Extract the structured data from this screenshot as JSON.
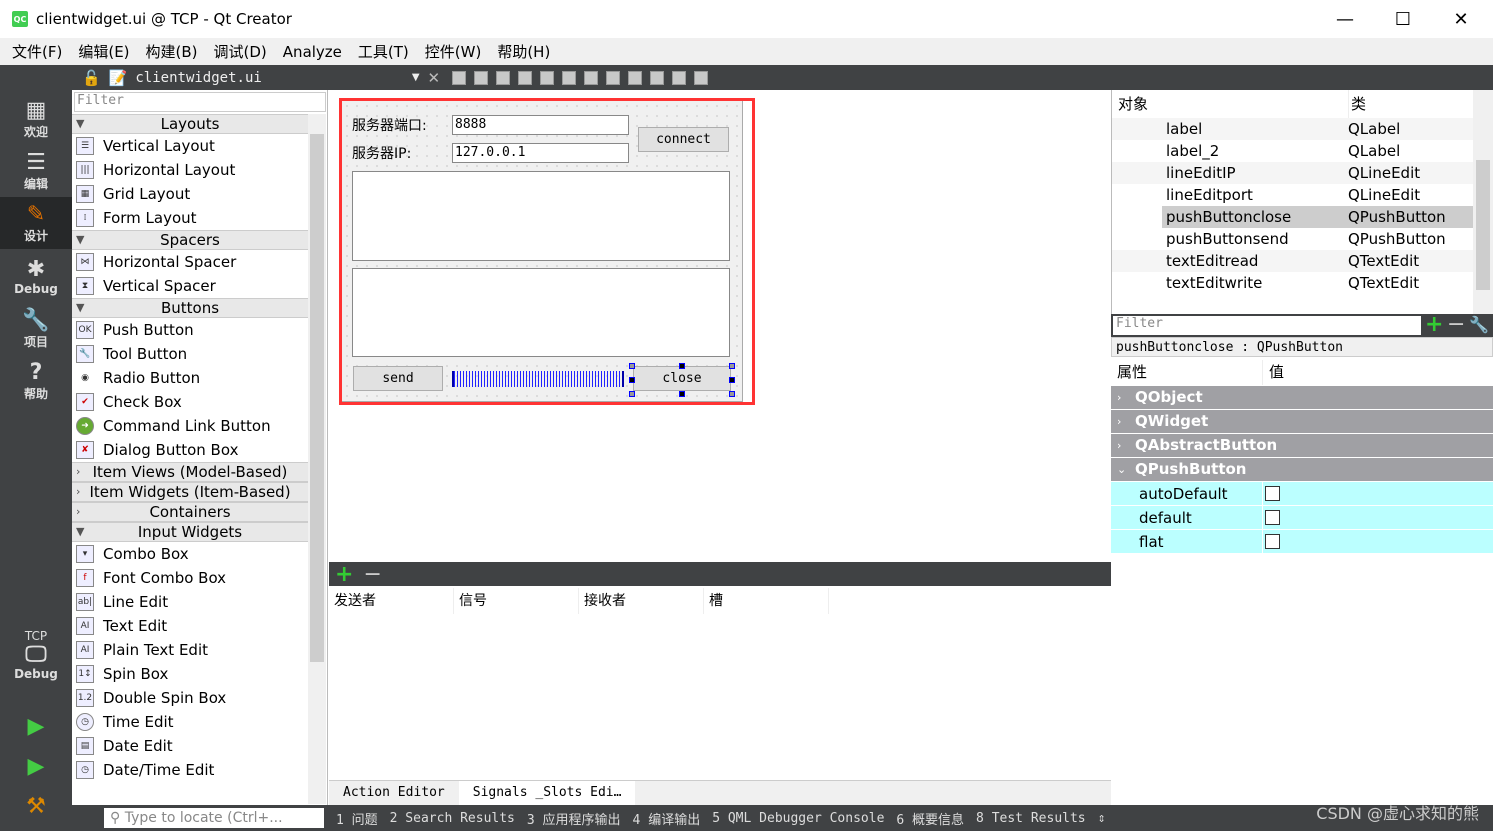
{
  "window": {
    "title": "clientwidget.ui @ TCP - Qt Creator",
    "logo": "QC",
    "minimize": "—",
    "maximize": "☐",
    "close": "✕"
  },
  "menu": [
    "文件(F)",
    "编辑(E)",
    "构建(B)",
    "调试(D)",
    "Analyze",
    "工具(T)",
    "控件(W)",
    "帮助(H)"
  ],
  "modes": [
    {
      "label": "欢迎",
      "icon": "grid-icon"
    },
    {
      "label": "编辑",
      "icon": "document-icon"
    },
    {
      "label": "设计",
      "icon": "pencil-icon"
    },
    {
      "label": "Debug",
      "icon": "bug-icon"
    },
    {
      "label": "项目",
      "icon": "wrench-icon"
    },
    {
      "label": "帮助",
      "icon": "help-icon"
    }
  ],
  "kit": {
    "project": "TCP",
    "mode": "Debug"
  },
  "toolbar": {
    "file": "clientwidget.ui"
  },
  "widgetbox": {
    "filter_placeholder": "Filter",
    "layouts": "Layouts",
    "layout_items": [
      "Vertical Layout",
      "Horizontal Layout",
      "Grid Layout",
      "Form Layout"
    ],
    "spacers": "Spacers",
    "spacer_items": [
      "Horizontal Spacer",
      "Vertical Spacer"
    ],
    "buttons": "Buttons",
    "button_items": [
      "Push Button",
      "Tool Button",
      "Radio Button",
      "Check Box",
      "Command Link Button",
      "Dialog Button Box"
    ],
    "item_views": "Item Views (Model-Based)",
    "item_widgets": "Item Widgets (Item-Based)",
    "containers": "Containers",
    "input": "Input Widgets",
    "input_items": [
      "Combo Box",
      "Font Combo Box",
      "Line Edit",
      "Text Edit",
      "Plain Text Edit",
      "Spin Box",
      "Double Spin Box",
      "Time Edit",
      "Date Edit",
      "Date/Time Edit"
    ]
  },
  "form": {
    "port_label": "服务器端口:",
    "port_value": "8888",
    "ip_label": "服务器IP:",
    "ip_value": "127.0.0.1",
    "connect": "connect",
    "send": "send",
    "close": "close"
  },
  "signals": {
    "headers": [
      "发送者",
      "信号",
      "接收者",
      "槽"
    ],
    "tabs": [
      "Action Editor",
      "Signals _Slots Edi…"
    ]
  },
  "object_inspector": {
    "col_object": "对象",
    "col_class": "类",
    "rows": [
      {
        "name": "label",
        "cls": "QLabel"
      },
      {
        "name": "label_2",
        "cls": "QLabel"
      },
      {
        "name": "lineEditIP",
        "cls": "QLineEdit"
      },
      {
        "name": "lineEditport",
        "cls": "QLineEdit"
      },
      {
        "name": "pushButtonclose",
        "cls": "QPushButton",
        "selected": true
      },
      {
        "name": "pushButtonsend",
        "cls": "QPushButton"
      },
      {
        "name": "textEditread",
        "cls": "QTextEdit"
      },
      {
        "name": "textEditwrite",
        "cls": "QTextEdit"
      }
    ]
  },
  "property_editor": {
    "filter_placeholder": "Filter",
    "object_class": "pushButtonclose : QPushButton",
    "col_property": "属性",
    "col_value": "值",
    "groups": [
      "QObject",
      "QWidget",
      "QAbstractButton",
      "QPushButton"
    ],
    "props": [
      {
        "name": "autoDefault",
        "checked": false
      },
      {
        "name": "default",
        "checked": false
      },
      {
        "name": "flat",
        "checked": false
      }
    ]
  },
  "statusbar": {
    "locate_placeholder": "Type to locate (Ctrl+...",
    "panes": [
      "1 问题",
      "2 Search Results",
      "3 应用程序输出",
      "4 编译输出",
      "5 QML Debugger Console",
      "6 概要信息",
      "8 Test Results"
    ]
  },
  "watermark": "CSDN @虚心求知的熊"
}
